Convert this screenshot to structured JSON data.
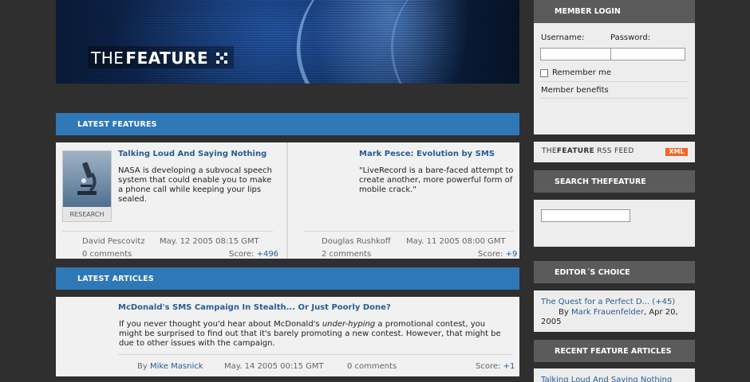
{
  "header": {
    "logo_thin": "THE",
    "logo_bold": "FEATURE"
  },
  "latest_features": {
    "heading": "LATEST FEATURES",
    "items": [
      {
        "title": "Talking Loud And Saying Nothing",
        "body": "NASA is developing a subvocal speech system that could enable you to make a phone call while keeping your lips sealed.",
        "thumb_caption": "RESEARCH",
        "author": "David Pescovitz",
        "date": "May. 12 2005 08:15 GMT",
        "comments": "0 comments",
        "score_label": "Score:",
        "score": "+496"
      },
      {
        "title": "Mark Pesce: Evolution by SMS",
        "body": "\"LiveRecord is a bare-faced attempt to create another, more powerful form of mobile crack.\"",
        "author": "Douglas Rushkoff",
        "date": "May. 11 2005 08:00 GMT",
        "comments": "2 comments",
        "score_label": "Score:",
        "score": "+9"
      }
    ]
  },
  "latest_articles": {
    "heading": "LATEST ARTICLES",
    "items": [
      {
        "title": "McDonald's SMS Campaign In Stealth... Or Just Poorly Done?",
        "body_pre": "If you never thought you'd hear about McDonald's ",
        "body_em": "under-hyping",
        "body_post": " a promotional contest, you might be surprised to find out that it's barely promoting a new contest. However, that might be due to other issues with the campaign.",
        "by": "By",
        "author": "Mike Masnick",
        "date": "May. 14 2005 00:15 GMT",
        "comments": "0 comments",
        "score_label": "Score:",
        "score": "+1"
      }
    ]
  },
  "sidebar": {
    "login": {
      "heading": "MEMBER LOGIN",
      "username_label": "Username:",
      "password_label": "Password:",
      "username_value": "",
      "password_value": "",
      "remember_label": "Remember me",
      "benefits_link": "Member benefits"
    },
    "rss": {
      "label_thin": "THE",
      "label_bold": "FEATURE",
      "label_rest": " RSS FEED",
      "badge": "XML"
    },
    "search": {
      "heading": "SEARCH THEFEATURE",
      "value": ""
    },
    "editors_choice": {
      "heading": "EDITOR´S CHOICE",
      "link": "The Quest for a Perfect D... (+45)",
      "by": "By",
      "author": "Mark Frauenfelder",
      "date": ", Apr 20, 2005"
    },
    "recent": {
      "heading": "RECENT FEATURE ARTICLES",
      "first_link": "Talking Loud And Saying Nothing"
    }
  },
  "colors": {
    "section_bar": "#2f78b8",
    "sidebar_header": "#5b5b5b",
    "link": "#2a5c93",
    "page_bg": "#2f2f2f",
    "xml_badge": "#f26522"
  }
}
